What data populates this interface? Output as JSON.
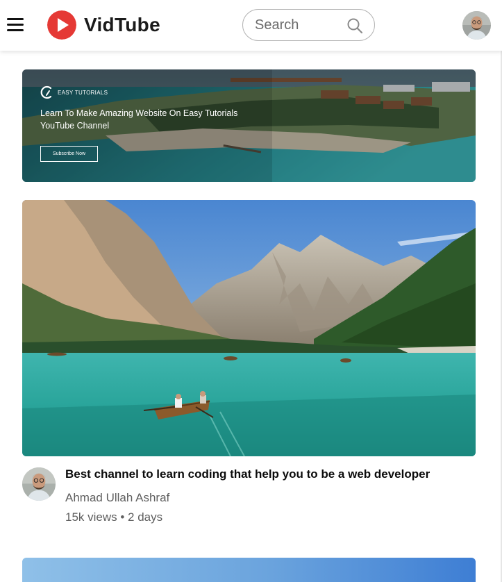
{
  "header": {
    "app_name": "VidTube",
    "search_placeholder": "Search",
    "brand_color": "#e53935"
  },
  "icons": {
    "menu": "hamburger-icon",
    "logo": "play-icon",
    "search": "magnifier-icon",
    "avatar": "user-avatar"
  },
  "banner": {
    "brand": "EASY TUTORIALS",
    "title_line1": "Learn To Make Amazing Website On Easy Tutorials",
    "title_line2": "YouTube Channel",
    "button_label": "Subscribe Now"
  },
  "video": {
    "title": "Best channel to learn coding that help you to be a web developer",
    "channel": "Ahmad Ullah Ashraf",
    "meta": "15k views • 2 days"
  }
}
